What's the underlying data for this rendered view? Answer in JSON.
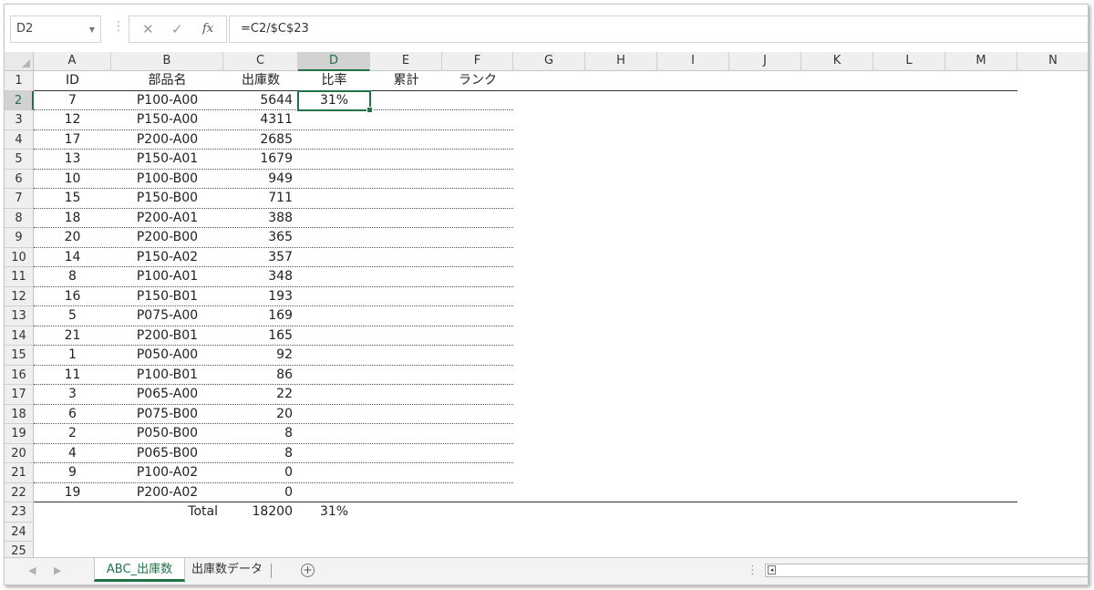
{
  "formula_bar": {
    "name_box": "D2",
    "fx_label": "fx",
    "formula": "=C2/$C$23"
  },
  "columns": [
    "A",
    "B",
    "C",
    "D",
    "E",
    "F",
    "G",
    "H",
    "I",
    "J",
    "K",
    "L",
    "M",
    "N"
  ],
  "row_numbers": [
    "1",
    "2",
    "3",
    "4",
    "5",
    "6",
    "7",
    "8",
    "9",
    "10",
    "11",
    "12",
    "13",
    "14",
    "15",
    "16",
    "17",
    "18",
    "19",
    "20",
    "21",
    "22",
    "23",
    "24",
    "25"
  ],
  "headers": {
    "a": "ID",
    "b": "部品名",
    "c": "出庫数",
    "d": "比率",
    "e": "累計",
    "f": "ランク"
  },
  "rows": [
    {
      "id": "7",
      "name": "P100-A00",
      "qty": "5644",
      "ratio": "31%"
    },
    {
      "id": "12",
      "name": "P150-A00",
      "qty": "4311",
      "ratio": ""
    },
    {
      "id": "17",
      "name": "P200-A00",
      "qty": "2685",
      "ratio": ""
    },
    {
      "id": "13",
      "name": "P150-A01",
      "qty": "1679",
      "ratio": ""
    },
    {
      "id": "10",
      "name": "P100-B00",
      "qty": "949",
      "ratio": ""
    },
    {
      "id": "15",
      "name": "P150-B00",
      "qty": "711",
      "ratio": ""
    },
    {
      "id": "18",
      "name": "P200-A01",
      "qty": "388",
      "ratio": ""
    },
    {
      "id": "20",
      "name": "P200-B00",
      "qty": "365",
      "ratio": ""
    },
    {
      "id": "14",
      "name": "P150-A02",
      "qty": "357",
      "ratio": ""
    },
    {
      "id": "8",
      "name": "P100-A01",
      "qty": "348",
      "ratio": ""
    },
    {
      "id": "16",
      "name": "P150-B01",
      "qty": "193",
      "ratio": ""
    },
    {
      "id": "5",
      "name": "P075-A00",
      "qty": "169",
      "ratio": ""
    },
    {
      "id": "21",
      "name": "P200-B01",
      "qty": "165",
      "ratio": ""
    },
    {
      "id": "1",
      "name": "P050-A00",
      "qty": "92",
      "ratio": ""
    },
    {
      "id": "11",
      "name": "P100-B01",
      "qty": "86",
      "ratio": ""
    },
    {
      "id": "3",
      "name": "P065-A00",
      "qty": "22",
      "ratio": ""
    },
    {
      "id": "6",
      "name": "P075-B00",
      "qty": "20",
      "ratio": ""
    },
    {
      "id": "2",
      "name": "P050-B00",
      "qty": "8",
      "ratio": ""
    },
    {
      "id": "4",
      "name": "P065-B00",
      "qty": "8",
      "ratio": ""
    },
    {
      "id": "9",
      "name": "P100-A02",
      "qty": "0",
      "ratio": ""
    },
    {
      "id": "19",
      "name": "P200-A02",
      "qty": "0",
      "ratio": ""
    }
  ],
  "total": {
    "label": "Total",
    "qty": "18200",
    "ratio": "31%"
  },
  "selected": {
    "column": "D",
    "row": "2"
  },
  "sheet_tabs": [
    {
      "label": "ABC_出庫数",
      "active": true
    },
    {
      "label": "出庫数データ",
      "active": false
    }
  ],
  "icons": {
    "cancel": "close-icon",
    "enter": "check-icon",
    "add_sheet": "plus-circle-icon"
  },
  "colors": {
    "accent": "#217346"
  }
}
